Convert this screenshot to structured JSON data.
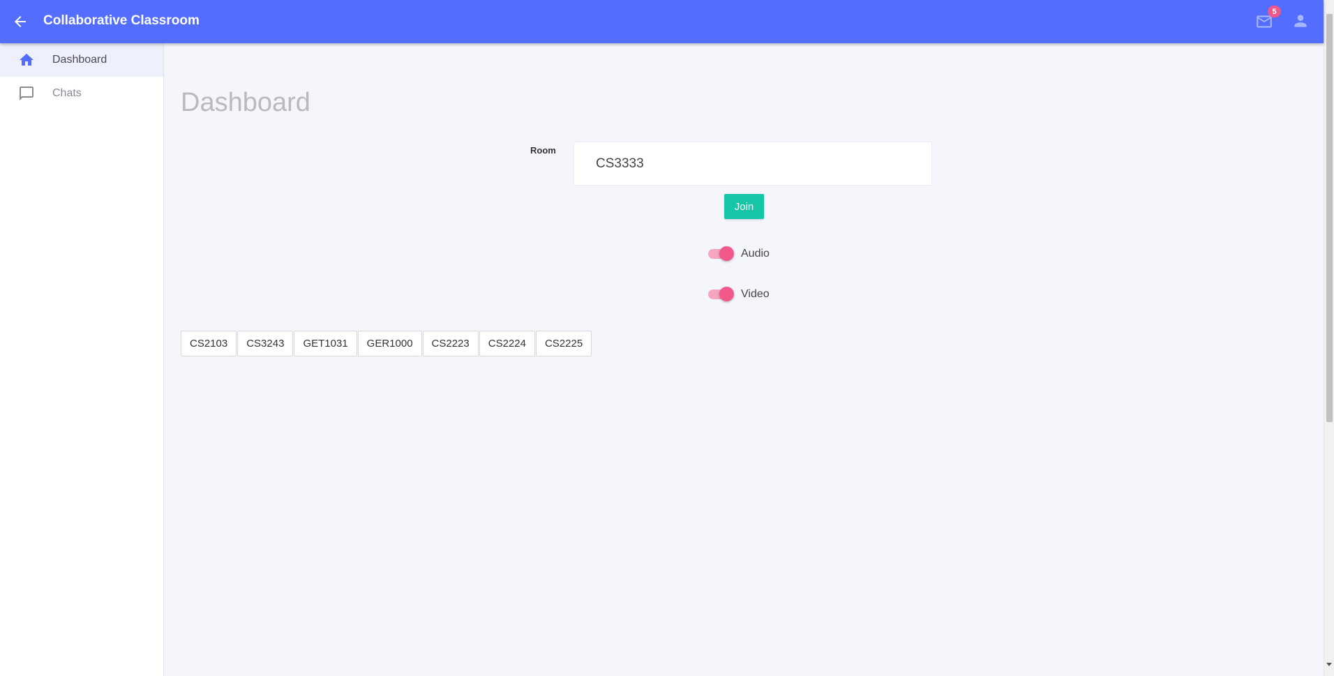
{
  "appbar": {
    "title": "Collaborative Classroom",
    "mail_badge_count": "5",
    "accent_color": "#536dfe"
  },
  "sidebar": {
    "items": [
      {
        "label": "Dashboard",
        "icon": "home-icon",
        "active": true
      },
      {
        "label": "Chats",
        "icon": "chat-icon",
        "active": false
      }
    ]
  },
  "main": {
    "title": "Dashboard",
    "room_label": "Room",
    "room_value": "CS3333",
    "join_label": "Join",
    "toggles": [
      {
        "label": "Audio",
        "on": true
      },
      {
        "label": "Video",
        "on": true
      }
    ],
    "rooms": [
      "CS2103",
      "CS3243",
      "GET1031",
      "GER1000",
      "CS2223",
      "CS2224",
      "CS2225"
    ]
  }
}
